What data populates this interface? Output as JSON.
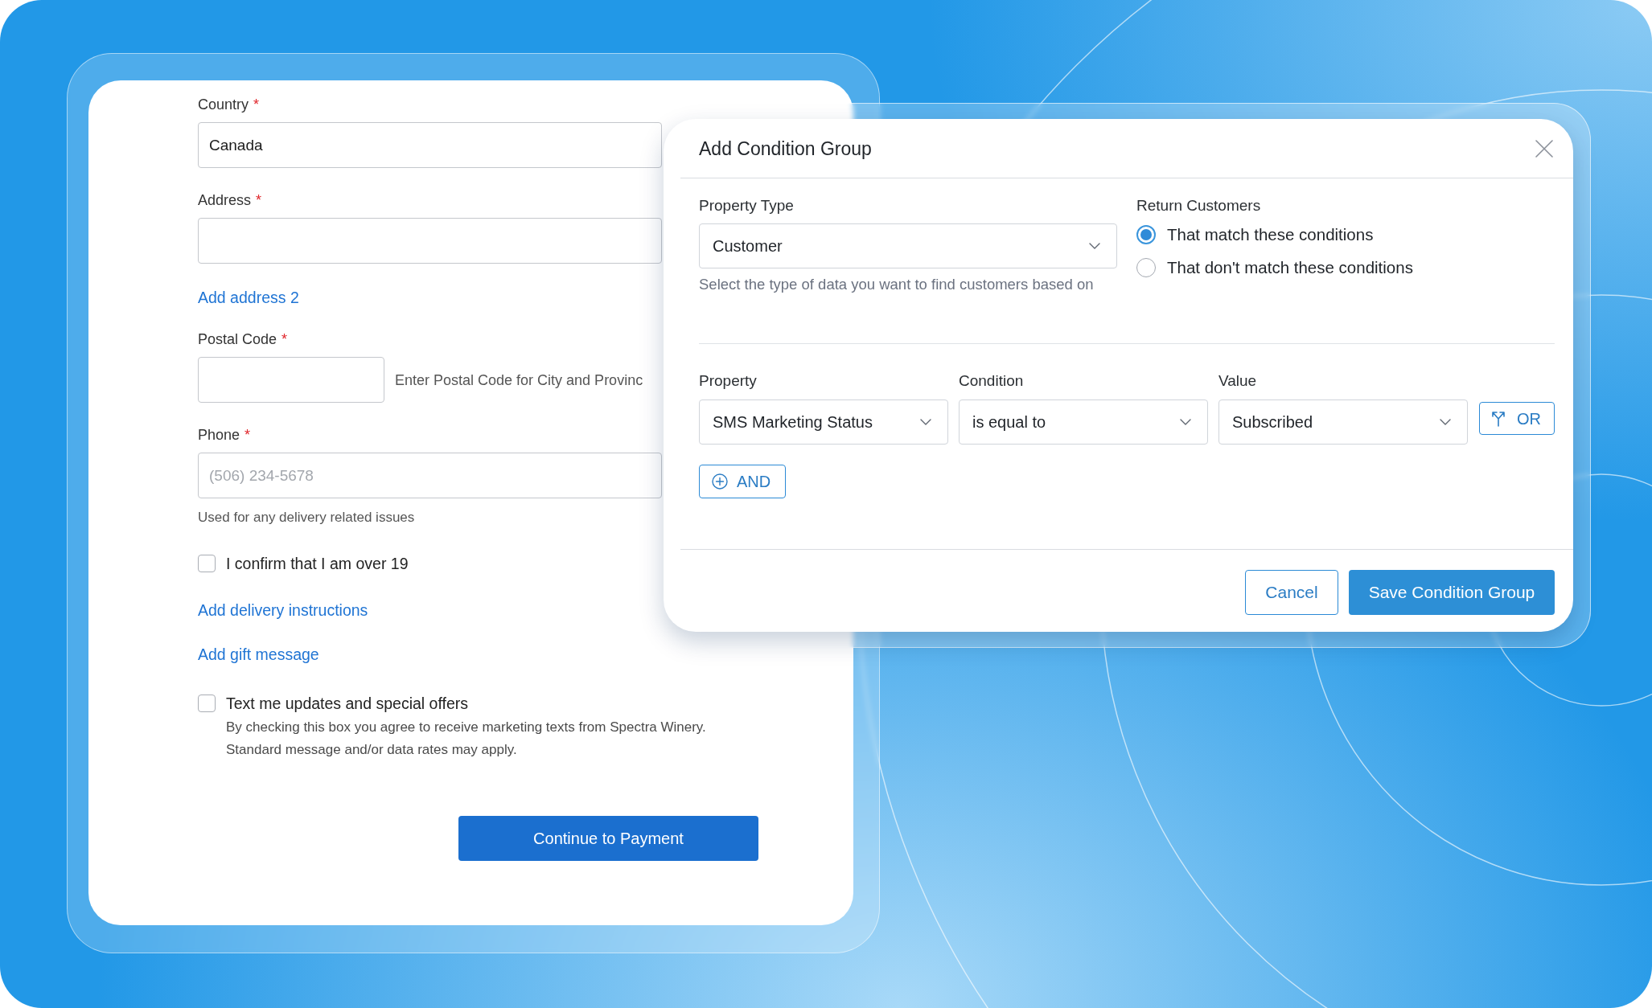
{
  "checkout_form": {
    "fields": [
      {
        "kind": "input",
        "label": "Country",
        "required_mark": "*",
        "value": "Canada"
      },
      {
        "kind": "input",
        "label": "Address",
        "required_mark": "*"
      },
      {
        "kind": "link",
        "text": "Add address 2"
      },
      {
        "kind": "postal",
        "label": "Postal Code",
        "required_mark": "*",
        "hint": "Enter Postal Code for City and Provinc"
      },
      {
        "kind": "input",
        "label": "Phone",
        "required_mark": "*",
        "placeholder": "(506) 234-5678",
        "helper": "Used for any delivery related issues"
      },
      {
        "kind": "checkbox",
        "label": "I confirm that I am over 19",
        "checked": false
      },
      {
        "kind": "link",
        "text": "Add delivery instructions"
      },
      {
        "kind": "link",
        "text": "Add gift message"
      },
      {
        "kind": "checkbox",
        "label": "Text me updates and special offers",
        "checked": false,
        "description": [
          "By checking this box you agree to receive marketing texts from Spectra Winery.",
          "Standard message and/or data rates may apply."
        ]
      }
    ],
    "submit_button": "Continue to Payment"
  },
  "dialog": {
    "title": "Add Condition Group",
    "property_type": {
      "label": "Property Type",
      "value": "Customer",
      "hint": "Select the type of data you want to find customers based on"
    },
    "return_customers": {
      "label": "Return Customers",
      "options": [
        {
          "label": "That match these conditions",
          "selected": true
        },
        {
          "label": "That don't match these conditions",
          "selected": false
        }
      ]
    },
    "columns": [
      "Property",
      "Condition",
      "Value"
    ],
    "conditions": [
      {
        "property": "SMS Marketing Status",
        "condition": "is equal to",
        "value": "Subscribed",
        "or_button": "OR"
      }
    ],
    "and_button": "AND",
    "buttons": [
      {
        "kind": "secondary",
        "label": "Cancel"
      },
      {
        "kind": "primary",
        "label": "Save Condition Group"
      }
    ]
  }
}
